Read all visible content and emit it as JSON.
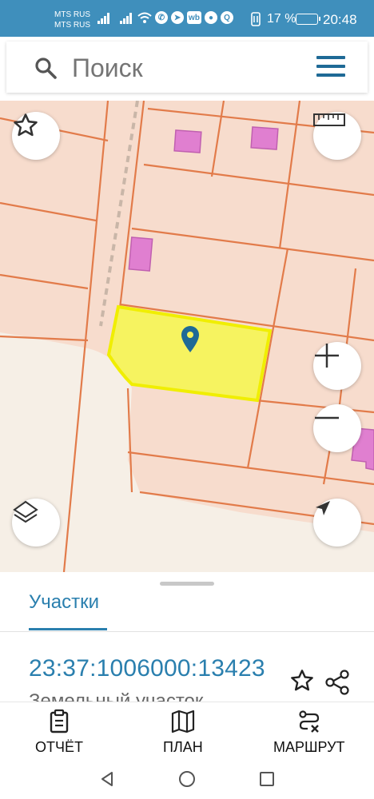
{
  "status_bar": {
    "carrier_1": "MTS RUS",
    "carrier_2": "MTS RUS",
    "battery_percent": "17 %",
    "time": "20:48",
    "icons": [
      "signal-icon",
      "signal-icon",
      "wifi-icon",
      "whatsapp-icon",
      "telegram-icon",
      "wb-icon",
      "bulb-icon",
      "search-app-icon",
      "vibrate-icon",
      "battery-icon"
    ]
  },
  "search": {
    "placeholder": "Поиск"
  },
  "map": {
    "buttons": [
      "favorites",
      "ruler",
      "zoom-in",
      "zoom-out",
      "layers",
      "locate"
    ],
    "colors": {
      "background": "#f7dccd",
      "boundary": "#e27b4a",
      "selected_fill": "#f6f35a",
      "selected_stroke": "#f0ee00",
      "building": "#e07fd0",
      "road": "#f6efe6",
      "marker": "#1f6a96"
    }
  },
  "sheet": {
    "tab_label": "Участки",
    "cadastral_number": "23:37:1006000:13423",
    "parcel_type": "Земельный участок"
  },
  "bottom_nav": {
    "report": "ОТЧЁТ",
    "plan": "ПЛАН",
    "route": "МАРШРУТ"
  },
  "colors": {
    "accent": "#2a7fae",
    "status_bar": "#3f8fbc"
  }
}
